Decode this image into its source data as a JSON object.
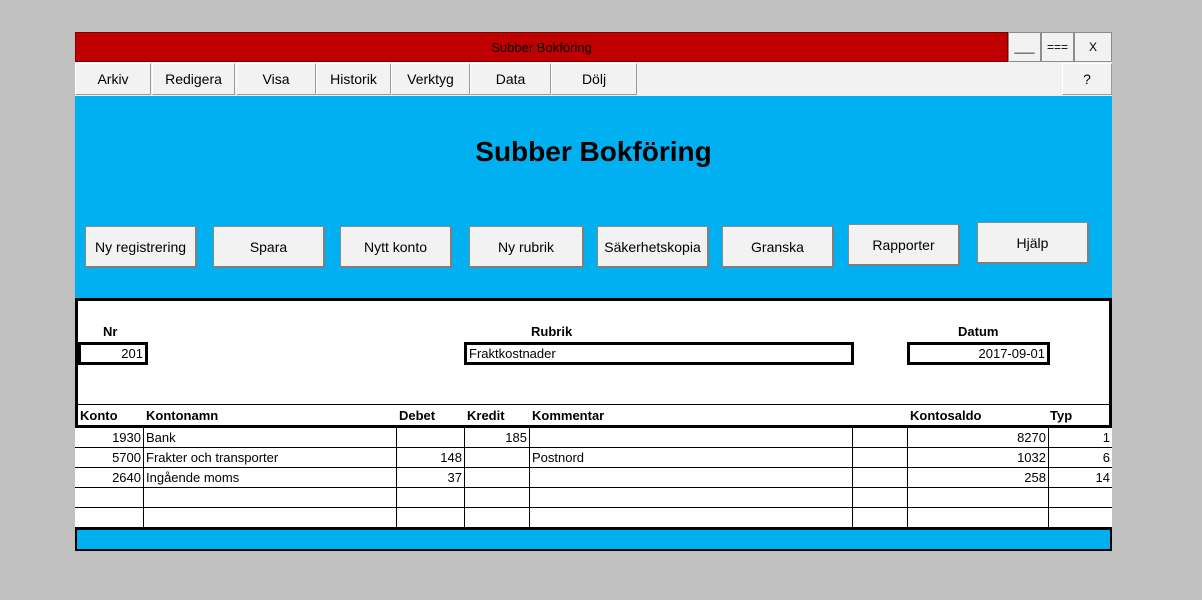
{
  "window": {
    "title": "Subber Bokföring",
    "controls": {
      "minimize": "___",
      "maximize": "===",
      "close": "X"
    }
  },
  "menu": {
    "items": [
      "Arkiv",
      "Redigera",
      "Visa",
      "Historik",
      "Verktyg",
      "Data",
      "Dölj"
    ],
    "help": "?"
  },
  "banner": {
    "title": "Subber Bokföring"
  },
  "actions": [
    "Ny registrering",
    "Spara",
    "Nytt konto",
    "Ny rubrik",
    "Säkerhetskopia",
    "Granska",
    "Rapporter",
    "Hjälp"
  ],
  "form": {
    "nr_label": "Nr",
    "nr_value": "201",
    "rubrik_label": "Rubrik",
    "rubrik_value": "Fraktkostnader",
    "datum_label": "Datum",
    "datum_value": "2017-09-01"
  },
  "table": {
    "headers": {
      "konto": "Konto",
      "kontonamn": "Kontonamn",
      "debet": "Debet",
      "kredit": "Kredit",
      "kommentar": "Kommentar",
      "kontosaldo": "Kontosaldo",
      "typ": "Typ"
    },
    "rows": [
      {
        "konto": "1930",
        "kontonamn": "Bank",
        "debet": "",
        "kredit": "185",
        "kommentar": "",
        "extra": "",
        "kontosaldo": "8270",
        "typ": "1"
      },
      {
        "konto": "5700",
        "kontonamn": "Frakter och transporter",
        "debet": "148",
        "kredit": "",
        "kommentar": "Postnord",
        "extra": "",
        "kontosaldo": "1032",
        "typ": "6"
      },
      {
        "konto": "2640",
        "kontonamn": "Ingående moms",
        "debet": "37",
        "kredit": "",
        "kommentar": "",
        "extra": "",
        "kontosaldo": "258",
        "typ": "14"
      },
      {
        "konto": "",
        "kontonamn": "",
        "debet": "",
        "kredit": "",
        "kommentar": "",
        "extra": "",
        "kontosaldo": "",
        "typ": ""
      },
      {
        "konto": "",
        "kontonamn": "",
        "debet": "",
        "kredit": "",
        "kommentar": "",
        "extra": "",
        "kontosaldo": "",
        "typ": ""
      }
    ]
  },
  "colors": {
    "titlebar": "#c00000",
    "accent": "#00b0f0",
    "background": "#c0c0c0"
  }
}
